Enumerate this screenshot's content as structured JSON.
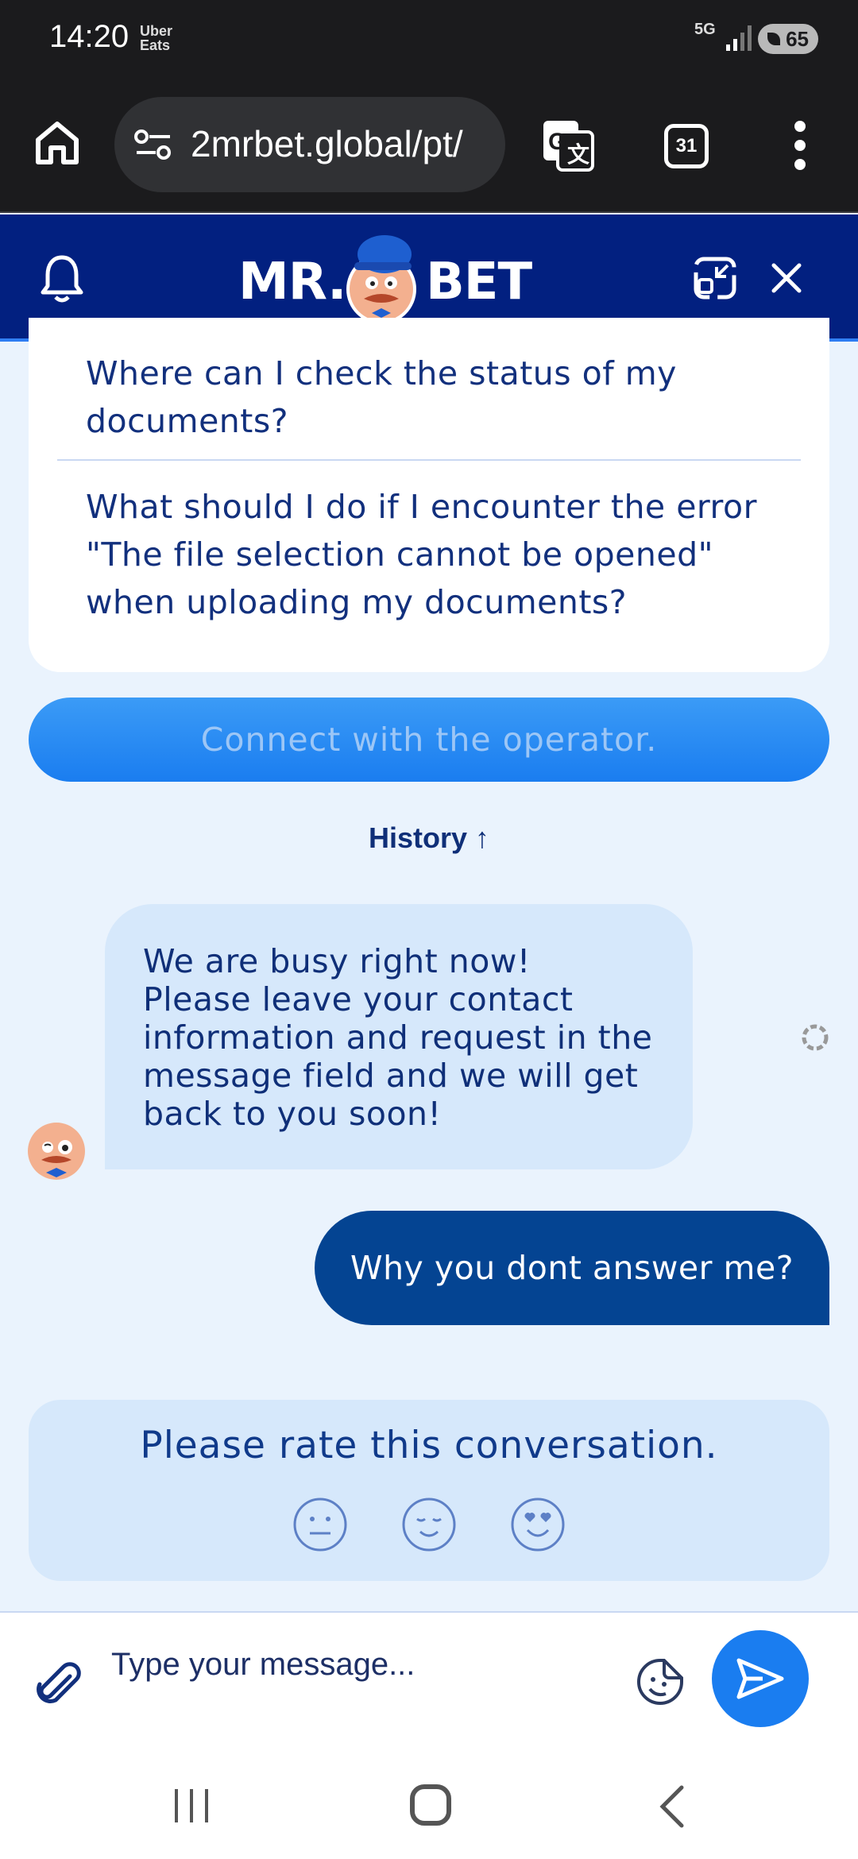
{
  "status_bar": {
    "time": "14:20",
    "notification_app": "Uber\nEats",
    "network": "5G",
    "battery": "65"
  },
  "browser": {
    "url": "2mrbet.global/pt/",
    "tab_count": "31"
  },
  "header": {
    "logo_left": "MR.",
    "logo_right": "BET",
    "accent_color": "#022080"
  },
  "faq": {
    "items": [
      "Where can I check the status of my documents?",
      "What should I do if I encounter the error \"The file selection cannot be opened\" when uploading my documents?"
    ]
  },
  "connect_button": "Connect with the operator.",
  "history_label": "History ↑",
  "messages": {
    "bot": "We are busy right now!\nPlease leave your contact information and request in the message field and we will get back to you soon!",
    "user": "Why you dont answer me?"
  },
  "rating": {
    "title": "Please rate this conversation.",
    "options": [
      "neutral-face-icon",
      "smiling-face-icon",
      "heart-eyes-face-icon"
    ]
  },
  "composer": {
    "placeholder": "Type your message..."
  }
}
